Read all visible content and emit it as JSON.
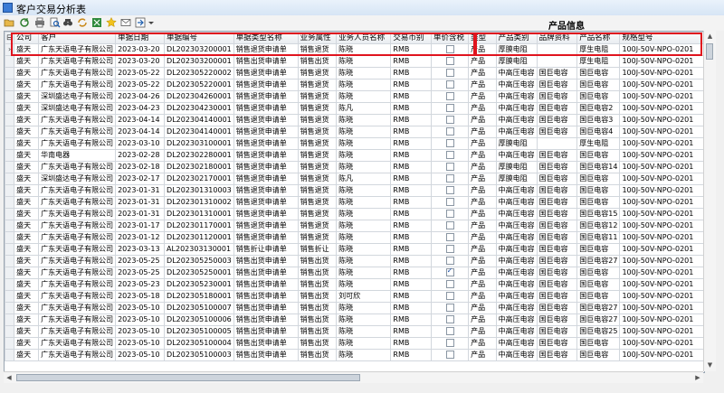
{
  "window": {
    "title": "客户交易分析表"
  },
  "toolbar": {
    "icons": [
      "folder-open-icon",
      "refresh-icon",
      "print-icon",
      "print-preview-icon",
      "filter-icon",
      "sync-icon",
      "excel-icon",
      "star-icon",
      "mail-icon",
      "export-icon",
      "dropdown-icon"
    ]
  },
  "group_header": {
    "product_info": "产品信息"
  },
  "grid": {
    "expand_glyph": "⊟",
    "columns": [
      "公司",
      "客户",
      "单据日期",
      "单据编号",
      "单据类型名称",
      "业务属性",
      "业务人员名称",
      "交易币别",
      "单价含税",
      "类型",
      "产品类别",
      "品牌资料",
      "产品名称",
      "规格型号"
    ],
    "rows": [
      [
        "盛天",
        "广东天语电子有限公司",
        "2023-03-20",
        "DL202303200001",
        "销售退货申请单",
        "销售退货",
        "陈晓",
        "RMB",
        false,
        "产品",
        "厚膜电阻",
        "",
        "厚生电阻",
        "100J-50V-NPO-0201"
      ],
      [
        "盛天",
        "广东天语电子有限公司",
        "2023-03-20",
        "DL202303200001",
        "销售出货申请单",
        "销售出货",
        "陈晓",
        "RMB",
        false,
        "产品",
        "厚膜电阻",
        "",
        "厚生电阻",
        "100J-50V-NPO-0201"
      ],
      [
        "盛天",
        "广东天语电子有限公司",
        "2023-05-22",
        "DL202305220002",
        "销售退货申请单",
        "销售退货",
        "陈晓",
        "RMB",
        false,
        "产品",
        "中高压电容",
        "国巨电容",
        "国巨电容",
        "100J-50V-NPO-0201"
      ],
      [
        "盛天",
        "广东天语电子有限公司",
        "2023-05-22",
        "DL202305220001",
        "销售退货申请单",
        "销售退货",
        "陈晓",
        "RMB",
        false,
        "产品",
        "中高压电容",
        "国巨电容",
        "国巨电容",
        "100J-50V-NPO-0201"
      ],
      [
        "盛天",
        "深圳盛达电子有限公司",
        "2023-04-26",
        "DL202304260001",
        "销售退货申请单",
        "销售退货",
        "陈晓",
        "RMB",
        false,
        "产品",
        "中高压电容",
        "国巨电容",
        "国巨电容",
        "100J-50V-NPO-0201"
      ],
      [
        "盛天",
        "深圳盛达电子有限公司",
        "2023-04-23",
        "DL202304230001",
        "销售退货申请单",
        "销售退货",
        "陈凡",
        "RMB",
        false,
        "产品",
        "中高压电容",
        "国巨电容",
        "国巨电容2",
        "100J-50V-NPO-0201"
      ],
      [
        "盛天",
        "广东天语电子有限公司",
        "2023-04-14",
        "DL202304140001",
        "销售退货申请单",
        "销售退货",
        "陈晓",
        "RMB",
        false,
        "产品",
        "中高压电容",
        "国巨电容",
        "国巨电容3",
        "100J-50V-NPO-0201"
      ],
      [
        "盛天",
        "广东天语电子有限公司",
        "2023-04-14",
        "DL202304140001",
        "销售退货申请单",
        "销售退货",
        "陈晓",
        "RMB",
        false,
        "产品",
        "中高压电容",
        "国巨电容",
        "国巨电容4",
        "100J-50V-NPO-0201"
      ],
      [
        "盛天",
        "广东天语电子有限公司",
        "2023-03-10",
        "DL202303100001",
        "销售退货申请单",
        "销售退货",
        "陈晓",
        "RMB",
        false,
        "产品",
        "厚膜电阻",
        "",
        "厚生电阻",
        "100J-50V-NPO-0201"
      ],
      [
        "盛天",
        "华南电器",
        "2023-02-28",
        "DL202302280001",
        "销售退货申请单",
        "销售退货",
        "陈晓",
        "RMB",
        false,
        "产品",
        "中高压电容",
        "国巨电容",
        "国巨电容",
        "100J-50V-NPO-0201"
      ],
      [
        "盛天",
        "广东天语电子有限公司",
        "2023-02-18",
        "DL202302180001",
        "销售退货申请单",
        "销售退货",
        "陈晓",
        "RMB",
        false,
        "产品",
        "厚膜电阻",
        "国巨电容",
        "国巨电容14",
        "100J-50V-NPO-0201"
      ],
      [
        "盛天",
        "深圳盛达电子有限公司",
        "2023-02-17",
        "DL202302170001",
        "销售退货申请单",
        "销售退货",
        "陈凡",
        "RMB",
        false,
        "产品",
        "厚膜电阻",
        "国巨电容",
        "国巨电容",
        "100J-50V-NPO-0201"
      ],
      [
        "盛天",
        "广东天语电子有限公司",
        "2023-01-31",
        "DL202301310003",
        "销售退货申请单",
        "销售退货",
        "陈晓",
        "RMB",
        false,
        "产品",
        "中高压电容",
        "国巨电容",
        "国巨电容",
        "100J-50V-NPO-0201"
      ],
      [
        "盛天",
        "广东天语电子有限公司",
        "2023-01-31",
        "DL202301310002",
        "销售退货申请单",
        "销售退货",
        "陈晓",
        "RMB",
        false,
        "产品",
        "中高压电容",
        "国巨电容",
        "国巨电容",
        "100J-50V-NPO-0201"
      ],
      [
        "盛天",
        "广东天语电子有限公司",
        "2023-01-31",
        "DL202301310001",
        "销售退货申请单",
        "销售退货",
        "陈晓",
        "RMB",
        false,
        "产品",
        "中高压电容",
        "国巨电容",
        "国巨电容15",
        "100J-50V-NPO-0201"
      ],
      [
        "盛天",
        "广东天语电子有限公司",
        "2023-01-17",
        "DL202301170001",
        "销售退货申请单",
        "销售退货",
        "陈晓",
        "RMB",
        false,
        "产品",
        "中高压电容",
        "国巨电容",
        "国巨电容12",
        "100J-50V-NPO-0201"
      ],
      [
        "盛天",
        "广东天语电子有限公司",
        "2023-01-12",
        "DL202301120001",
        "销售退货申请单",
        "销售退货",
        "陈晓",
        "RMB",
        false,
        "产品",
        "中高压电容",
        "国巨电容",
        "国巨电容11",
        "100J-50V-NPO-0201"
      ],
      [
        "盛天",
        "广东天语电子有限公司",
        "2023-03-13",
        "AL202303130001",
        "销售折让申请单",
        "销售折让",
        "陈晓",
        "RMB",
        false,
        "产品",
        "中高压电容",
        "国巨电容",
        "国巨电容",
        "100J-50V-NPO-0201"
      ],
      [
        "盛天",
        "广东天语电子有限公司",
        "2023-05-25",
        "DL202305250003",
        "销售出货申请单",
        "销售出货",
        "陈晓",
        "RMB",
        false,
        "产品",
        "中高压电容",
        "国巨电容",
        "国巨电容27",
        "100J-50V-NPO-0201"
      ],
      [
        "盛天",
        "广东天语电子有限公司",
        "2023-05-25",
        "DL202305250001",
        "销售出货申请单",
        "销售出货",
        "陈晓",
        "RMB",
        true,
        "产品",
        "中高压电容",
        "国巨电容",
        "国巨电容",
        "100J-50V-NPO-0201"
      ],
      [
        "盛天",
        "广东天语电子有限公司",
        "2023-05-23",
        "DL202305230001",
        "销售出货申请单",
        "销售出货",
        "陈晓",
        "RMB",
        false,
        "产品",
        "中高压电容",
        "国巨电容",
        "国巨电容",
        "100J-50V-NPO-0201"
      ],
      [
        "盛天",
        "广东天语电子有限公司",
        "2023-05-18",
        "DL202305180001",
        "销售出货申请单",
        "销售出货",
        "刘可欣",
        "RMB",
        false,
        "产品",
        "中高压电容",
        "国巨电容",
        "国巨电容",
        "100J-50V-NPO-0201"
      ],
      [
        "盛天",
        "广东天语电子有限公司",
        "2023-05-10",
        "DL202305100007",
        "销售出货申请单",
        "销售出货",
        "陈晓",
        "RMB",
        false,
        "产品",
        "中高压电容",
        "国巨电容",
        "国巨电容27",
        "100J-50V-NPO-0201"
      ],
      [
        "盛天",
        "广东天语电子有限公司",
        "2023-05-10",
        "DL202305100006",
        "销售出货申请单",
        "销售出货",
        "陈晓",
        "RMB",
        false,
        "产品",
        "中高压电容",
        "国巨电容",
        "国巨电容27",
        "100J-50V-NPO-0201"
      ],
      [
        "盛天",
        "广东天语电子有限公司",
        "2023-05-10",
        "DL202305100005",
        "销售出货申请单",
        "销售出货",
        "陈晓",
        "RMB",
        false,
        "产品",
        "中高压电容",
        "国巨电容",
        "国巨电容25",
        "100J-50V-NPO-0201"
      ],
      [
        "盛天",
        "广东天语电子有限公司",
        "2023-05-10",
        "DL202305100004",
        "销售出货申请单",
        "销售出货",
        "陈晓",
        "RMB",
        false,
        "产品",
        "中高压电容",
        "国巨电容",
        "国巨电容",
        "100J-50V-NPO-0201"
      ],
      [
        "盛天",
        "广东天语电子有限公司",
        "2023-05-10",
        "DL202305100003",
        "销售出货申请单",
        "销售出货",
        "陈晓",
        "RMB",
        false,
        "产品",
        "中高压电容",
        "国巨电容",
        "国巨电容",
        "100J-50V-NPO-0201"
      ]
    ],
    "current_row_marker": "›"
  }
}
